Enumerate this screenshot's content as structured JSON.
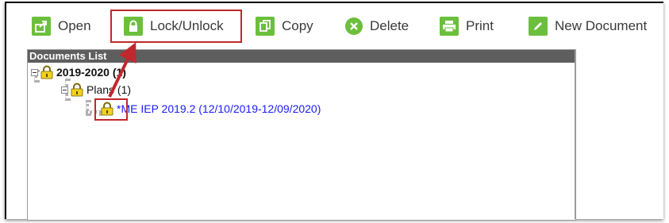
{
  "toolbar": {
    "open_label": "Open",
    "lock_label": "Lock/Unlock",
    "copy_label": "Copy",
    "delete_label": "Delete",
    "print_label": "Print",
    "new_document_label": "New Document"
  },
  "documents_panel": {
    "header": "Documents List",
    "tree": {
      "year_label": "2019-2020 (1)",
      "plans_label": "Plans (1)",
      "document_label": "*ME IEP 2019.2 (12/10/2019-12/09/2020)"
    }
  },
  "colors": {
    "icon_green": "#6cbf3d",
    "annotation_red": "#c0282d",
    "link_blue": "#1a1aff",
    "header_gray": "#5e5e5e"
  }
}
